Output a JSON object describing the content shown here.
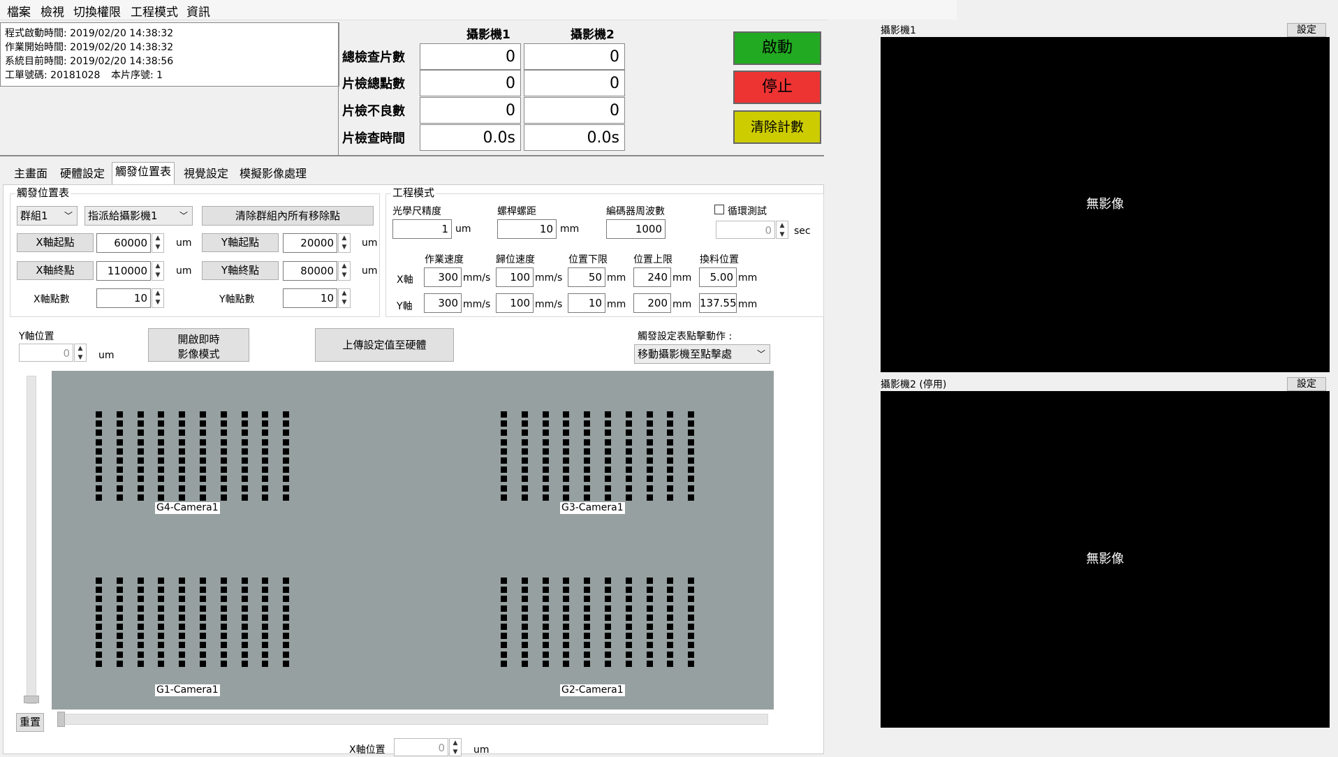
{
  "menu": [
    "檔案",
    "檢視",
    "切換權限",
    "工程模式",
    "資訊"
  ],
  "info": {
    "start_time": "程式啟動時間: 2019/02/20 14:38:32",
    "job_start": "作業開始時間: 2019/02/20 14:38:32",
    "sys_time": "系統目前時間: 2019/02/20 14:38:56",
    "work_order": "工單號碼: 20181028",
    "serial": "本片序號: 1"
  },
  "stats": {
    "cam1_header": "攝影機1",
    "cam2_header": "攝影機2",
    "rows": [
      {
        "label": "總檢查片數",
        "cam1": "0",
        "cam2": "0"
      },
      {
        "label": "片檢總點數",
        "cam1": "0",
        "cam2": "0"
      },
      {
        "label": "片檢不良數",
        "cam1": "0",
        "cam2": "0"
      },
      {
        "label": "片檢查時間",
        "cam1": "0.0s",
        "cam2": "0.0s"
      }
    ]
  },
  "buttons": {
    "start": "啟動",
    "stop": "停止",
    "clear": "清除計數",
    "start_color": "#22aa22",
    "stop_color": "#ee3333",
    "clear_color": "#cccc00"
  },
  "tabs": [
    "主畫面",
    "硬體設定",
    "觸發位置表",
    "視覺設定",
    "模擬影像處理"
  ],
  "trigger": {
    "title": "觸發位置表",
    "group_select": "群組1",
    "assign_select": "指派給攝影機1",
    "clear_points": "清除群組內所有移除點",
    "x_start_label": "X軸起點",
    "x_start": "60000",
    "x_end_label": "X軸終點",
    "x_end": "110000",
    "x_count_label": "X軸點數",
    "x_count": "10",
    "y_start_label": "Y軸起點",
    "y_start": "20000",
    "y_end_label": "Y軸終點",
    "y_end": "80000",
    "y_count_label": "Y軸點數",
    "y_count": "10",
    "unit": "um"
  },
  "engineering": {
    "title": "工程模式",
    "scale_label": "光學尺精度",
    "scale": "1",
    "scale_unit": "um",
    "pitch_label": "螺桿螺距",
    "pitch": "10",
    "pitch_unit": "mm",
    "encoder_label": "編碼器周波數",
    "encoder": "1000",
    "loop_label": "循環測試",
    "loop_value": "0",
    "loop_unit": "sec",
    "col_speed": "作業速度",
    "col_home": "歸位速度",
    "col_min": "位置下限",
    "col_max": "位置上限",
    "col_change": "換料位置",
    "x_label": "X軸",
    "y_label": "Y軸",
    "x": {
      "speed": "300",
      "home": "100",
      "min": "50",
      "max": "240",
      "change": "5.00"
    },
    "y": {
      "speed": "300",
      "home": "100",
      "min": "10",
      "max": "200",
      "change": "137.55"
    },
    "unit_speed": "mm/s",
    "unit_mm": "mm"
  },
  "ypos": {
    "label": "Y軸位置",
    "value": "0",
    "unit": "um"
  },
  "realtime_btn_line1": "開啟即時",
  "realtime_btn_line2": "影像模式",
  "upload_btn": "上傳設定值至硬體",
  "click_action": {
    "label": "觸發設定表點擊動作 :",
    "value": "移動攝影機至點擊處"
  },
  "groups": [
    {
      "label": "G4-Camera1"
    },
    {
      "label": "G3-Camera1"
    },
    {
      "label": "G1-Camera1"
    },
    {
      "label": "G2-Camera1"
    }
  ],
  "reset_btn": "重置",
  "xpos": {
    "label": "X軸位置",
    "value": "0",
    "unit": "um"
  },
  "camera1": {
    "title": "攝影機1",
    "settings": "設定",
    "no_image": "無影像"
  },
  "camera2": {
    "title": "攝影機2 (停用)",
    "settings": "設定",
    "no_image": "無影像"
  }
}
